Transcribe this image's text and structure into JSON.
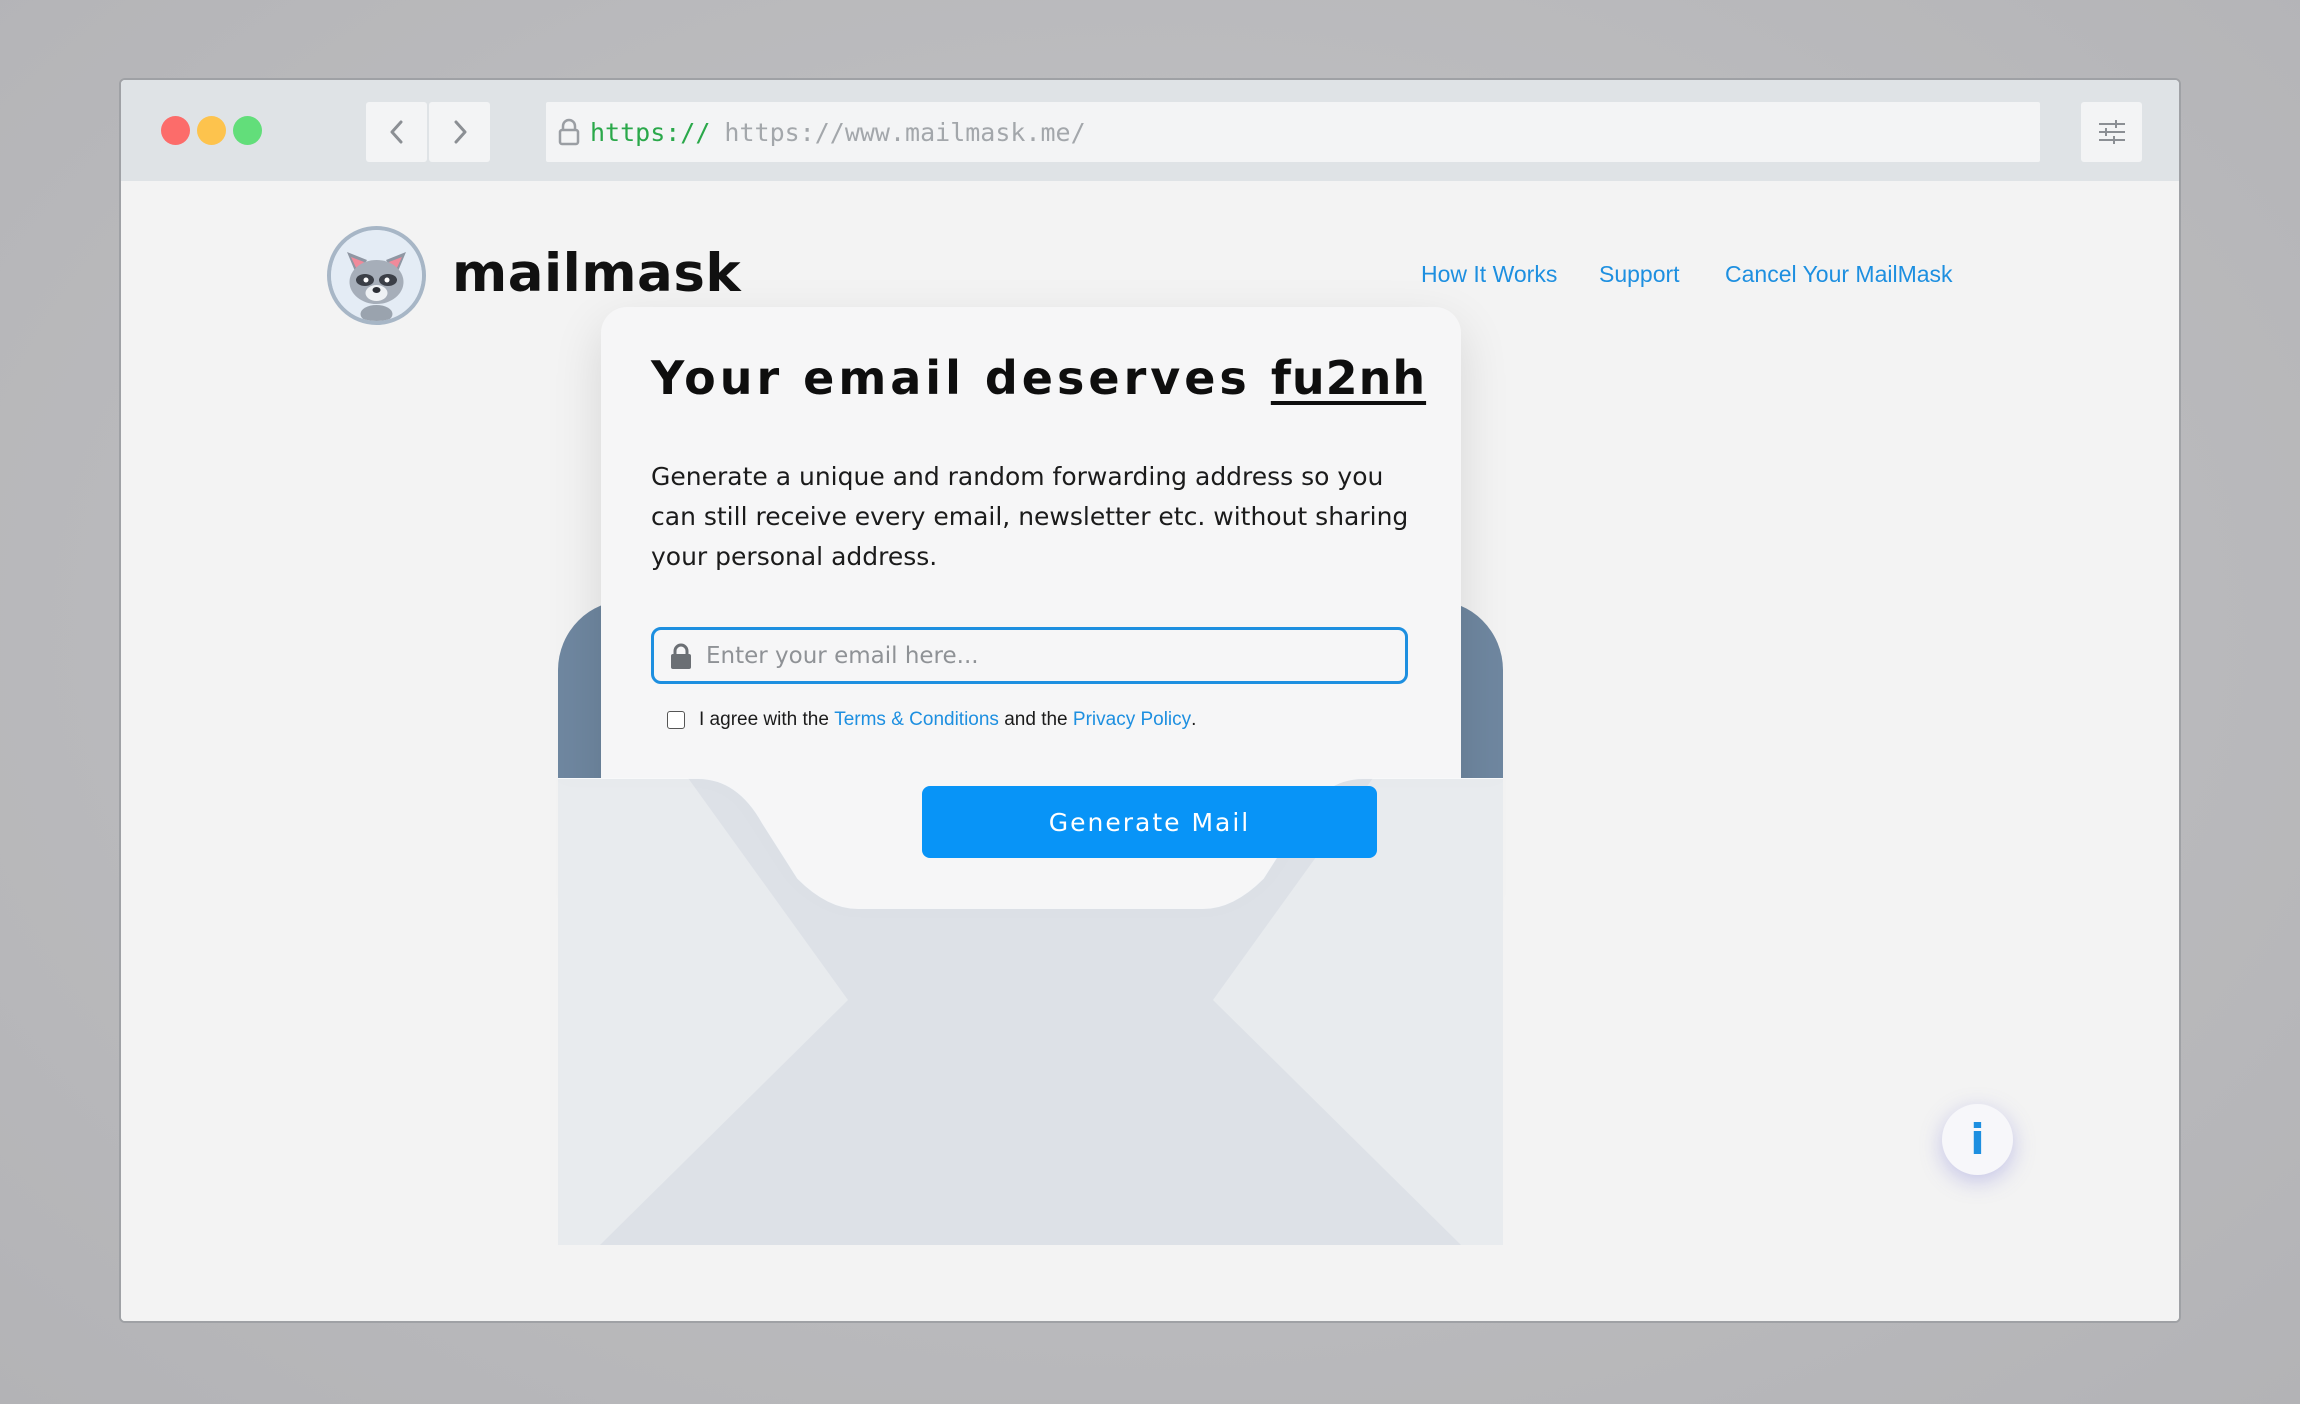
{
  "browser": {
    "url_scheme": "https://",
    "url": "https://www.mailmask.me/"
  },
  "header": {
    "brand": "mailmask",
    "nav": [
      {
        "label": "How It Works"
      },
      {
        "label": "Support"
      },
      {
        "label": "Cancel Your MailMask"
      }
    ]
  },
  "hero": {
    "headline_prefix": "Your email deserves",
    "headline_word": "fu2nh",
    "description": "Generate a unique and random forwarding address so you can still receive every email, newsletter etc. without sharing your personal address.",
    "email_placeholder": "Enter your email here...",
    "agree_prefix": "I agree with the",
    "terms_link": "Terms & Conditions",
    "agree_middle": "and the",
    "privacy_link": "Privacy Policy",
    "agree_suffix": ".",
    "generate_label": "Generate Mail"
  },
  "info_button": {
    "label": "i"
  },
  "icons": {
    "back": "chevron-left-icon",
    "forward": "chevron-right-icon",
    "lock": "lock-icon",
    "settings": "sliders-icon",
    "info": "info-icon"
  },
  "colors": {
    "accent": "#1d8fe0",
    "button": "#0894f7",
    "envelope_back": "#6f87a0"
  }
}
